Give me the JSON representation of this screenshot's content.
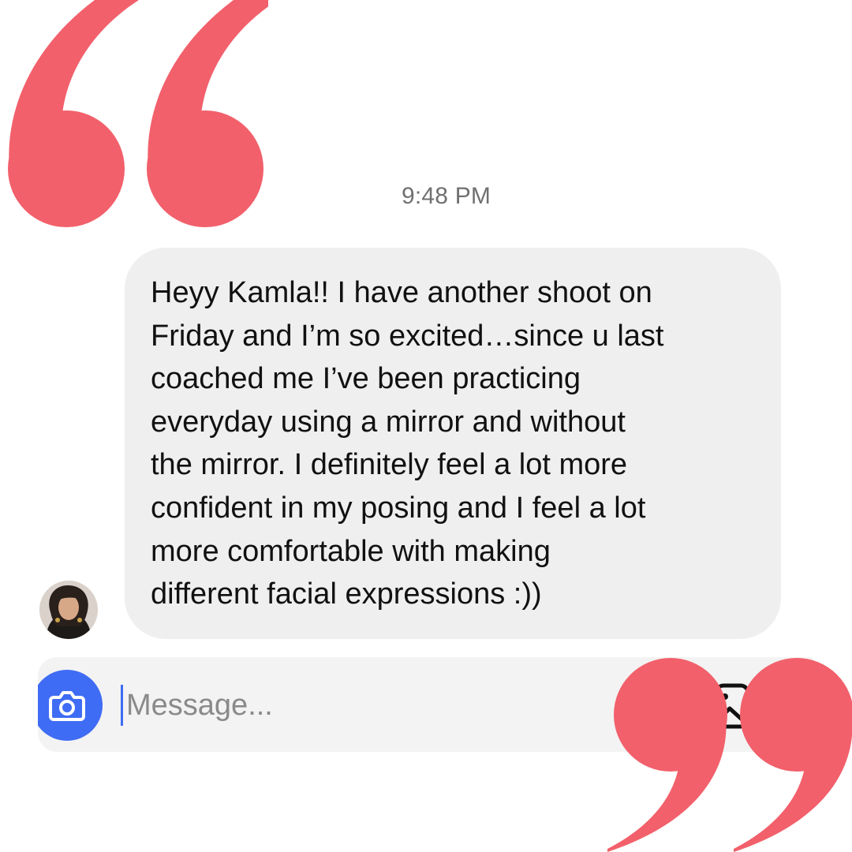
{
  "thread": {
    "timestamp": "9:48 PM",
    "message": {
      "sender_avatar": "avatar-photo",
      "text": "Heyy Kamla!! I have another shoot on\nFriday and I’m so excited…since u last\ncoached me I’ve been practicing\neveryday using a mirror and without\nthe mirror. I definitely feel a lot more\nconfident in my posing and I feel a lot\nmore comfortable with making\ndifferent facial expressions :))"
    }
  },
  "composer": {
    "placeholder": "Message...",
    "value": "",
    "camera_icon": "camera-icon",
    "gallery_icon": "gallery-icon"
  },
  "decor": {
    "quote_color": "#f2606b",
    "open_quote": "quote-open-icon",
    "close_quote": "quote-close-icon"
  },
  "colors": {
    "bubble": "#efefef",
    "accent": "#3f6cf4"
  }
}
